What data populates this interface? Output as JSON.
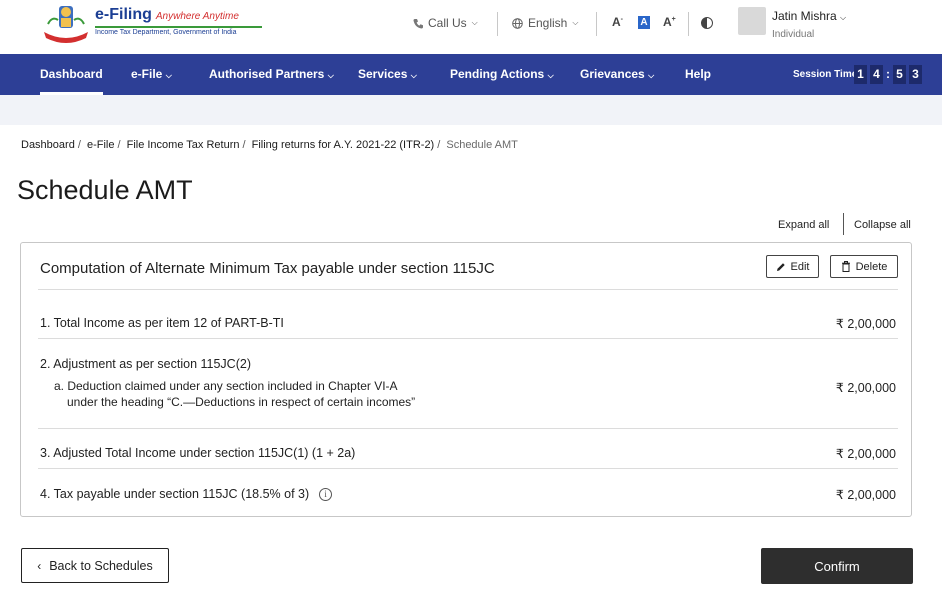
{
  "header": {
    "logo": {
      "title": "e-Filing",
      "tagline": "Anywhere Anytime",
      "subtitle": "Income Tax Department, Government of India"
    },
    "call_us": "Call Us",
    "language": "English",
    "font_sizes": [
      "A",
      "A",
      "A"
    ],
    "user": {
      "name": "Jatin Mishra",
      "role": "Individual"
    }
  },
  "nav": {
    "items": [
      {
        "label": "Dashboard",
        "active": true
      },
      {
        "label": "e-File",
        "dropdown": true
      },
      {
        "label": "Authorised Partners",
        "dropdown": true
      },
      {
        "label": "Services",
        "dropdown": true
      },
      {
        "label": "Pending Actions",
        "dropdown": true
      },
      {
        "label": "Grievances",
        "dropdown": true
      },
      {
        "label": "Help"
      }
    ],
    "session_label": "Session Time",
    "session_digits": [
      "1",
      "4",
      "5",
      "3"
    ]
  },
  "breadcrumb": {
    "items": [
      "Dashboard",
      "e-File",
      "File Income Tax Return",
      "Filing returns for A.Y. 2021-22 (ITR-2)"
    ],
    "current": "Schedule AMT"
  },
  "page": {
    "title": "Schedule AMT",
    "expand_all": "Expand all",
    "collapse_all": "Collapse all"
  },
  "card": {
    "title": "Computation of Alternate Minimum Tax payable under section 115JC",
    "edit_label": "Edit",
    "delete_label": "Delete",
    "rows": [
      {
        "label": "1. Total Income as per item 12 of PART-B-TI",
        "value": "₹ 2,00,000"
      },
      {
        "label": "2. Adjustment as per section 115JC(2)",
        "sub_line1": "a. Deduction claimed under any section included in Chapter  VI-A",
        "sub_line2": "under the heading “C.—Deductions in respect of certain incomes”",
        "value": "₹ 2,00,000"
      },
      {
        "label": "3. Adjusted Total Income under section 115JC(1) (1 + 2a)",
        "value": "₹ 2,00,000"
      },
      {
        "label": "4. Tax payable under section 115JC (18.5% of 3)",
        "value": "₹ 2,00,000"
      }
    ]
  },
  "footer": {
    "back_label": "Back to Schedules",
    "confirm_label": "Confirm"
  },
  "colors": {
    "nav_bg": "#2d3f96",
    "confirm_bg": "#2e2e2e",
    "brand_blue": "#1c3f94",
    "accent_red": "#d32f2f"
  },
  "icons": {
    "emblem": "national-emblem-icon",
    "phone": "phone-icon",
    "globe": "globe-icon",
    "contrast": "contrast-icon",
    "edit": "pencil-icon",
    "delete": "trash-icon",
    "info": "info-icon",
    "back": "chevron-left-icon"
  }
}
